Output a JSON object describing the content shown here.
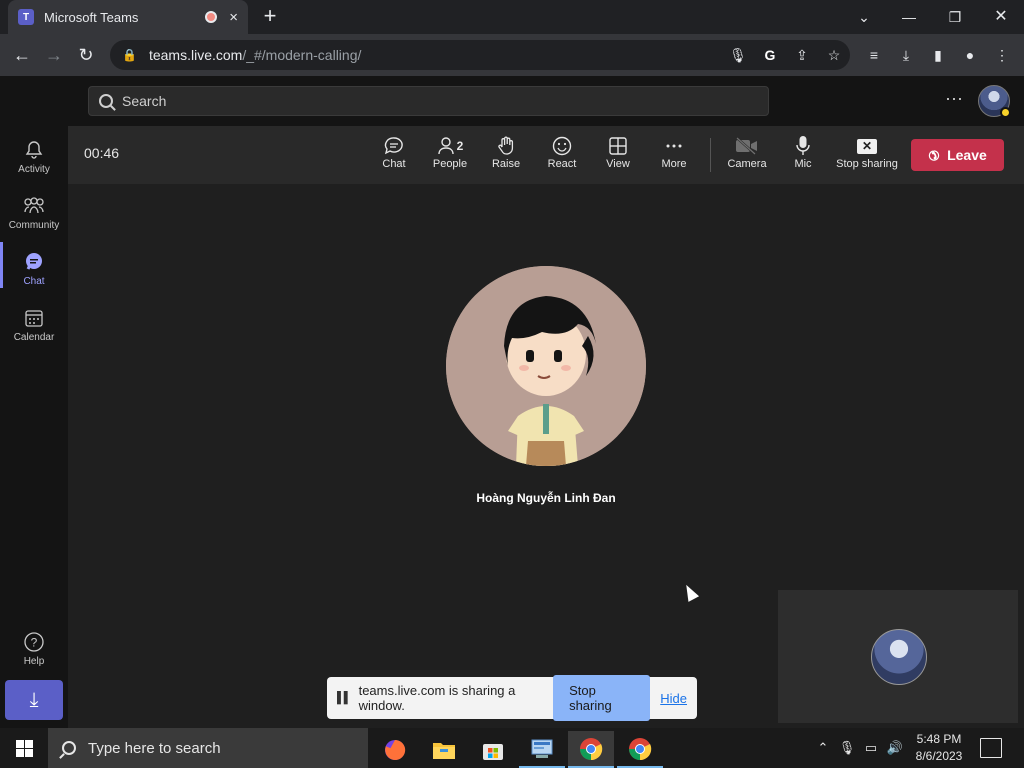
{
  "browser": {
    "tab_title": "Microsoft Teams",
    "favicon_text": "T",
    "url_host": "teams.live.com",
    "url_path": "/_#/modern-calling/",
    "new_tab": "+",
    "close_tab": "×"
  },
  "teams": {
    "search_placeholder": "Search",
    "more": "···"
  },
  "rail": {
    "items": [
      {
        "label": "Activity",
        "icon": "bell-icon"
      },
      {
        "label": "Community",
        "icon": "community-icon"
      },
      {
        "label": "Chat",
        "icon": "chat-icon",
        "active": true
      },
      {
        "label": "Calendar",
        "icon": "calendar-icon"
      }
    ],
    "help_label": "Help"
  },
  "call": {
    "timer": "00:46",
    "people_count": "2",
    "buttons": {
      "chat": "Chat",
      "people": "People",
      "raise": "Raise",
      "react": "React",
      "view": "View",
      "more": "More",
      "camera": "Camera",
      "mic": "Mic",
      "stop_sharing": "Stop sharing"
    },
    "leave": "Leave",
    "participant_name": "Hoàng Nguyễn Linh Đan"
  },
  "share_banner": {
    "message": "teams.live.com is sharing a window.",
    "stop": "Stop sharing",
    "hide": "Hide"
  },
  "taskbar": {
    "search_placeholder": "Type here to search",
    "time": "5:48 PM",
    "date": "8/6/2023"
  },
  "colors": {
    "teams_purple": "#5b5fc7",
    "leave_red": "#c4314b",
    "active_rail": "#9ea2ff"
  }
}
